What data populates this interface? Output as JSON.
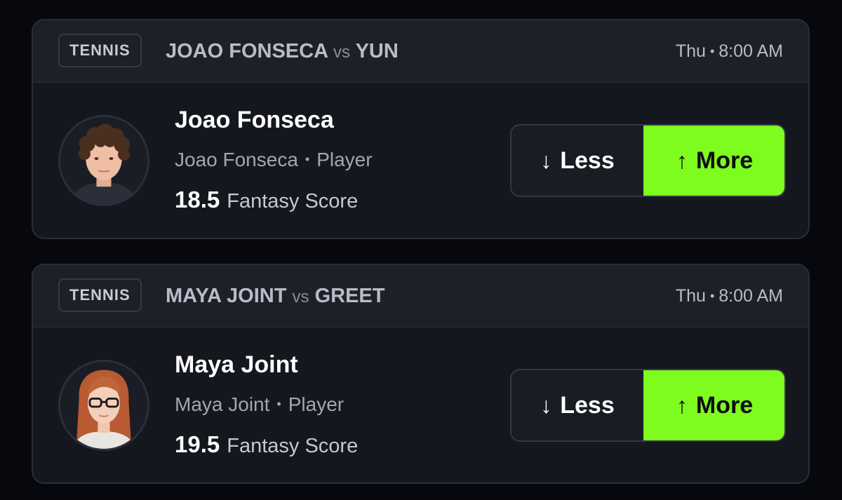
{
  "cards": [
    {
      "sport": "TENNIS",
      "matchup": {
        "player_a": "JOAO FONSECA",
        "vs": "vs",
        "player_b": "YUN"
      },
      "time": {
        "day": "Thu",
        "separator": "•",
        "clock": "8:00 AM"
      },
      "player": {
        "name": "Joao Fonseca",
        "sub_name": "Joao Fonseca",
        "separator": "•",
        "role": "Player",
        "line": "18.5",
        "stat": "Fantasy Score"
      },
      "less": {
        "arrow": "↓",
        "label": "Less"
      },
      "more": {
        "arrow": "↑",
        "label": "More"
      }
    },
    {
      "sport": "TENNIS",
      "matchup": {
        "player_a": "MAYA JOINT",
        "vs": "vs",
        "player_b": "GREET"
      },
      "time": {
        "day": "Thu",
        "separator": "•",
        "clock": "8:00 AM"
      },
      "player": {
        "name": "Maya Joint",
        "sub_name": "Maya Joint",
        "separator": "•",
        "role": "Player",
        "line": "19.5",
        "stat": "Fantasy Score"
      },
      "less": {
        "arrow": "↓",
        "label": "Less"
      },
      "more": {
        "arrow": "↑",
        "label": "More"
      }
    }
  ],
  "colors": {
    "background": "#07080d",
    "card": "#15171f",
    "header": "#1e2029",
    "accent_more": "#7dfc1e"
  }
}
